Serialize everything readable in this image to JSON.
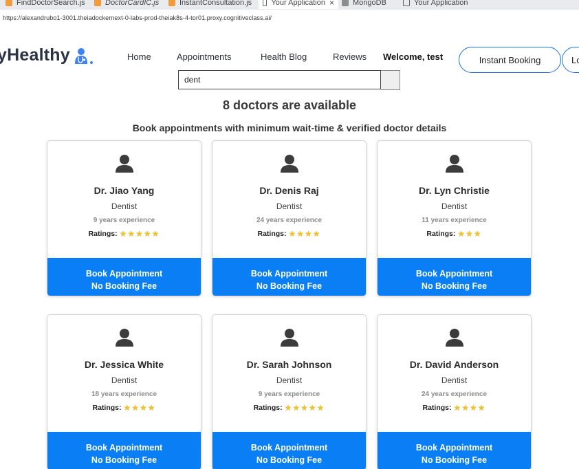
{
  "browser": {
    "tabs": [
      {
        "label": "FindDoctorSearch.js",
        "icon": "js-file-icon"
      },
      {
        "label": "DoctorCardIC.js",
        "icon": "js-file-icon"
      },
      {
        "label": "InstantConsultation.js",
        "icon": "js-file-icon"
      },
      {
        "label": "Your Application",
        "icon": "page-icon",
        "active": true
      },
      {
        "label": "MongoDB",
        "icon": "database-icon"
      },
      {
        "label": "Your Application",
        "icon": "page-icon"
      }
    ],
    "close_glyph": "×",
    "url": "https://alexandrubo1-3001.theiadockernext-0-labs-prod-theiak8s-4-tor01.proxy.cognitiveclass.ai/"
  },
  "navbar": {
    "logo_text": "yHealthy",
    "links": [
      "Home",
      "Appointments",
      "Health Blog",
      "Reviews"
    ],
    "welcome": "Welcome, test",
    "instant_booking": "Instant Booking",
    "login": "Lo"
  },
  "search": {
    "value": "dent"
  },
  "heading": {
    "count": "8 doctors are available",
    "subtitle": "Book appointments with minimum wait-time & verified doctor details"
  },
  "doctors": [
    {
      "name": "Dr. Jiao Yang",
      "speciality": "Dentist",
      "experience": "9 years experience",
      "ratings_label": "Ratings:",
      "stars": 5
    },
    {
      "name": "Dr. Denis Raj",
      "speciality": "Dentist",
      "experience": "24 years experience",
      "ratings_label": "Ratings:",
      "stars": 4
    },
    {
      "name": "Dr. Lyn Christie",
      "speciality": "Dentist",
      "experience": "11 years experience",
      "ratings_label": "Ratings:",
      "stars": 3
    },
    {
      "name": "Dr. Jessica White",
      "speciality": "Dentist",
      "experience": "18 years experience",
      "ratings_label": "Ratings:",
      "stars": 4
    },
    {
      "name": "Dr. Sarah Johnson",
      "speciality": "Dentist",
      "experience": "9 years experience",
      "ratings_label": "Ratings:",
      "stars": 5
    },
    {
      "name": "Dr. David Anderson",
      "speciality": "Dentist",
      "experience": "24 years experience",
      "ratings_label": "Ratings:",
      "stars": 4
    }
  ],
  "book_button": {
    "line1": "Book Appointment",
    "line2": "No Booking Fee"
  },
  "colors": {
    "accent": "#0a7ff5",
    "star": "#f1c12a",
    "text_dark": "#2b3345"
  },
  "icons": {
    "avatar": "user-icon",
    "logo": "doctor-icon",
    "rating": "star-icon"
  }
}
